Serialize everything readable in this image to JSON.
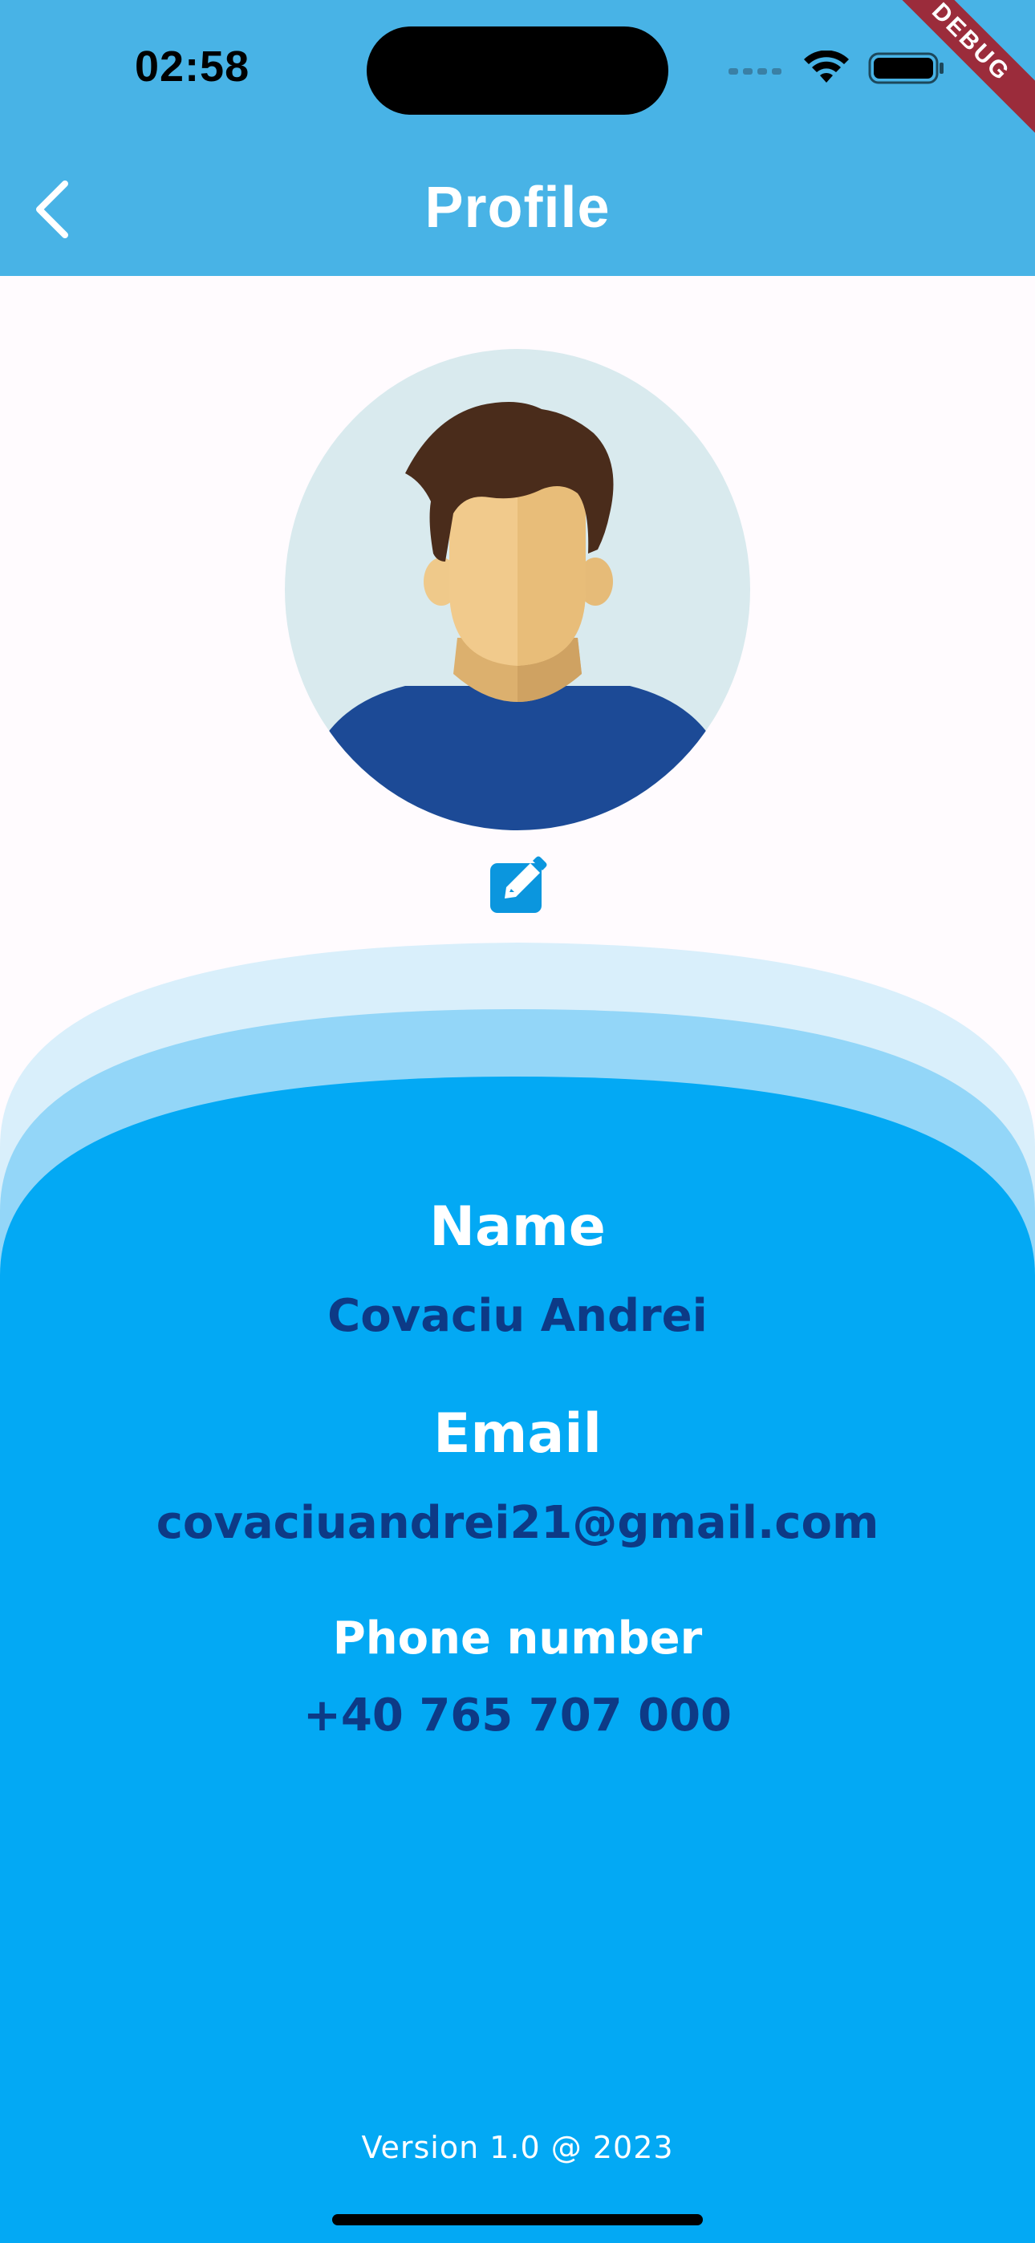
{
  "status_bar": {
    "time": "02:58",
    "icons": [
      "cellular-icon",
      "wifi-icon",
      "battery-icon"
    ]
  },
  "debug_banner": "DEBUG",
  "app_bar": {
    "title": "Profile",
    "back_icon": "chevron-left-icon"
  },
  "profile": {
    "avatar": "person-avatar",
    "edit_icon": "edit-square-icon",
    "fields": [
      {
        "label": "Name",
        "value": "Covaciu Andrei"
      },
      {
        "label": "Email",
        "value": "covaciuandrei21@gmail.com"
      },
      {
        "label": "Phone number",
        "value": "+40 765 707 000"
      }
    ]
  },
  "footer": {
    "version": "Version 1.0 @ 2023"
  },
  "colors": {
    "app_bar": "#48b3e6",
    "wave_light": "#d9effb",
    "wave_mid": "#93d6f8",
    "wave_main": "#03a9f4",
    "label": "#ffffff",
    "value": "#0d3a86",
    "edit_icon": "#0b96de"
  }
}
